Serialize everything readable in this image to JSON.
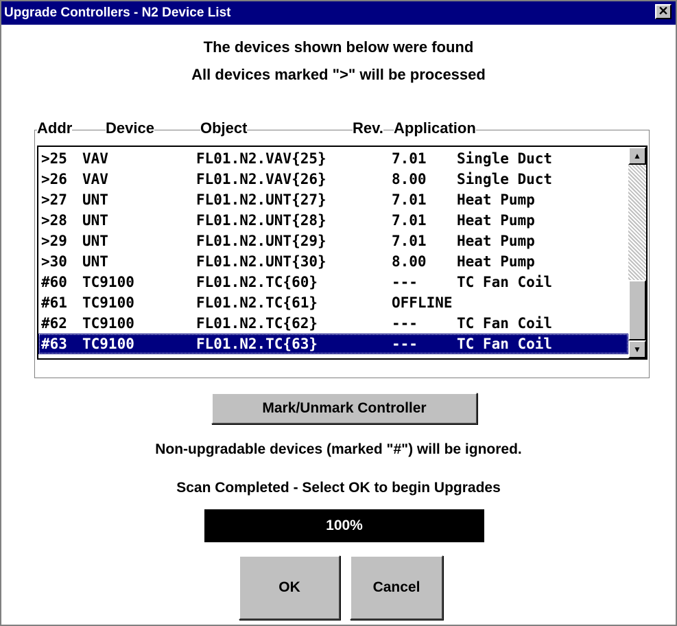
{
  "window": {
    "title": "Upgrade Controllers - N2 Device List",
    "close_glyph": "✕"
  },
  "headings": {
    "line1": "The devices shown below were found",
    "line2": "All devices marked \">\" will be processed"
  },
  "list": {
    "columns": {
      "addr": "Addr",
      "device": "Device",
      "object": "Object",
      "rev": "Rev.",
      "application": "Application"
    },
    "rows": [
      {
        "addr": ">25",
        "device": "VAV",
        "object": "FL01.N2.VAV{25}",
        "rev": "7.01",
        "application": "Single Duct"
      },
      {
        "addr": ">26",
        "device": "VAV",
        "object": "FL01.N2.VAV{26}",
        "rev": "8.00",
        "application": "Single Duct"
      },
      {
        "addr": ">27",
        "device": "UNT",
        "object": "FL01.N2.UNT{27}",
        "rev": "7.01",
        "application": "Heat Pump"
      },
      {
        "addr": ">28",
        "device": "UNT",
        "object": "FL01.N2.UNT{28}",
        "rev": "7.01",
        "application": "Heat Pump"
      },
      {
        "addr": ">29",
        "device": "UNT",
        "object": "FL01.N2.UNT{29}",
        "rev": "7.01",
        "application": "Heat Pump"
      },
      {
        "addr": ">30",
        "device": "UNT",
        "object": "FL01.N2.UNT{30}",
        "rev": "8.00",
        "application": "Heat Pump"
      },
      {
        "addr": "#60",
        "device": "TC9100",
        "object": "FL01.N2.TC{60}",
        "rev": "---",
        "application": "TC Fan Coil"
      },
      {
        "addr": "#61",
        "device": "TC9100",
        "object": "FL01.N2.TC{61}",
        "rev": "OFFLINE",
        "application": ""
      },
      {
        "addr": "#62",
        "device": "TC9100",
        "object": "FL01.N2.TC{62}",
        "rev": "---",
        "application": "TC Fan Coil"
      },
      {
        "addr": "#63",
        "device": "TC9100",
        "object": "FL01.N2.TC{63}",
        "rev": "---",
        "application": "TC Fan Coil"
      }
    ],
    "selected_index": 9
  },
  "buttons": {
    "mark": "Mark/Unmark Controller",
    "ok": "OK",
    "cancel": "Cancel"
  },
  "notes": {
    "ignored": "Non-upgradable devices (marked \"#\") will be ignored.",
    "status": "Scan Completed - Select OK to begin Upgrades"
  },
  "progress": {
    "label": "100%",
    "value": 1.0
  },
  "colors": {
    "titlebar": "#000080",
    "selection": "#000080",
    "progress": "#000000",
    "face": "#c0c0c0"
  },
  "icons": {
    "scroll_up": "triangle-up-icon",
    "scroll_down": "triangle-down-icon",
    "close": "close-icon"
  }
}
